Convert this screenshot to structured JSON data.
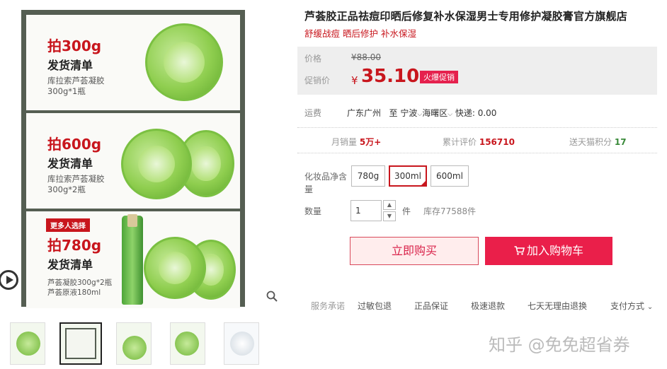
{
  "gallery": {
    "panels": [
      {
        "pick": "拍300g",
        "ship": "发货清单",
        "desc1": "库拉索芦荟凝胶",
        "desc2": "300g*1瓶",
        "tag": ""
      },
      {
        "pick": "拍600g",
        "ship": "发货清单",
        "desc1": "库拉索芦荟凝胶",
        "desc2": "300g*2瓶",
        "tag": ""
      },
      {
        "pick": "拍780g",
        "ship": "发货清单",
        "desc1": "芦荟凝胶300g*2瓶",
        "desc2": "芦荟原液180ml",
        "tag": "更多人选择"
      }
    ],
    "thumbnail_count": 5,
    "active_thumbnail": 2
  },
  "product": {
    "title": "芦荟胶正品祛痘印晒后修复补水保湿男士专用修护凝胶膏官方旗舰店",
    "subtitle": "舒缓战痘 晒后修护 补水保湿"
  },
  "price": {
    "orig_label": "价格",
    "orig_value": "¥88.00",
    "promo_label": "促销价",
    "currency": "¥",
    "value": "35.10",
    "badge": "火爆促销"
  },
  "shipping": {
    "label": "运费",
    "from": "广东广州",
    "to_word": "至",
    "city": "宁波",
    "district": "海曙区",
    "fee": "快递: 0.00"
  },
  "stats": {
    "monthly_label": "月销量",
    "monthly_value": "5万+",
    "reviews_label": "累计评价",
    "reviews_value": "156710",
    "points_label": "送天猫积分",
    "points_value": "17"
  },
  "options": {
    "label_line1": "化妆品净含",
    "label_line2": "量",
    "items": [
      "780g",
      "300ml",
      "600ml"
    ],
    "selected": "300ml"
  },
  "quantity": {
    "label": "数量",
    "value": "1",
    "unit": "件",
    "stock": "库存77588件"
  },
  "actions": {
    "buy": "立即购买",
    "cart": "加入购物车"
  },
  "services": {
    "label": "服务承诺",
    "items": [
      "过敏包退",
      "正品保证",
      "极速退款",
      "七天无理由退换"
    ],
    "payment": "支付方式"
  },
  "watermark": "知乎 @免免超省券",
  "colors": {
    "accent": "#c8161d",
    "cart": "#ea1f4a",
    "product_green": "#7bc042"
  }
}
